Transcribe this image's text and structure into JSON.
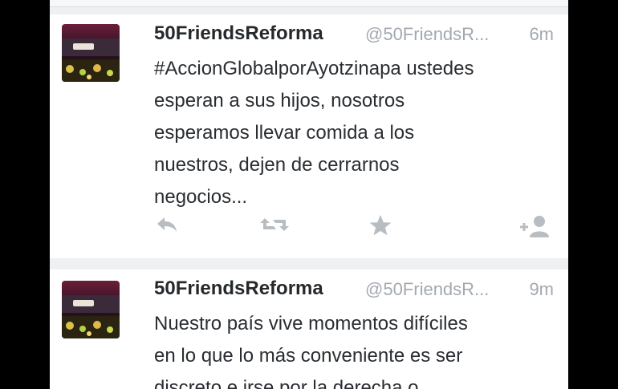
{
  "tweets": [
    {
      "name": "50FriendsReforma",
      "handle": "@50FriendsR...",
      "time": "6m",
      "lines": [
        "#AccionGlobalporAyotzinapa ustedes",
        "esperan a sus hijos, nosotros",
        "esperamos llevar comida a los",
        "nuestros, dejen de cerrarnos",
        "negocios..."
      ]
    },
    {
      "name": "50FriendsReforma",
      "handle": "@50FriendsR...",
      "time": "9m",
      "lines": [
        "Nuestro país vive momentos difíciles",
        "en lo que lo más conveniente es ser",
        "discreto e irse por la derecha o"
      ]
    }
  ],
  "icons": {
    "reply": "reply-icon",
    "retweet": "retweet-icon",
    "favorite": "star-icon",
    "follow": "follow-icon"
  },
  "colors": {
    "icon_gray": "#b8bdc2",
    "meta_gray": "#a3a9af",
    "background": "#eef0f2"
  }
}
